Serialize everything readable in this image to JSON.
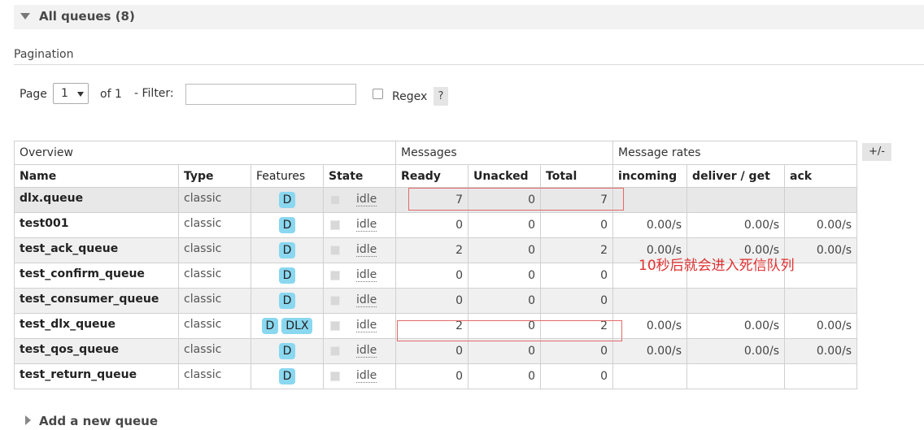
{
  "section": {
    "title": "All queues (8)",
    "add_new": "Add a new queue"
  },
  "pagination": {
    "label": "Pagination",
    "page_label": "Page",
    "page_value": "1",
    "of_label": "of 1",
    "filter_label": "- Filter:",
    "filter_value": "",
    "regex_label": "Regex",
    "help_label": "?"
  },
  "table": {
    "groups": {
      "overview": "Overview",
      "messages": "Messages",
      "rates": "Message rates"
    },
    "toggle_label": "+/-",
    "columns": {
      "name": "Name",
      "type": "Type",
      "features": "Features",
      "state": "State",
      "ready": "Ready",
      "unacked": "Unacked",
      "total": "Total",
      "incoming": "incoming",
      "deliver_get": "deliver / get",
      "ack": "ack"
    },
    "rows": [
      {
        "name": "dlx.queue",
        "type": "classic",
        "f1": "D",
        "f2": "",
        "state": "idle",
        "ready": "7",
        "unacked": "0",
        "total": "7",
        "incoming": "",
        "deliver": "",
        "ack": ""
      },
      {
        "name": "test001",
        "type": "classic",
        "f1": "D",
        "f2": "",
        "state": "idle",
        "ready": "0",
        "unacked": "0",
        "total": "0",
        "incoming": "0.00/s",
        "deliver": "0.00/s",
        "ack": "0.00/s"
      },
      {
        "name": "test_ack_queue",
        "type": "classic",
        "f1": "D",
        "f2": "",
        "state": "idle",
        "ready": "2",
        "unacked": "0",
        "total": "2",
        "incoming": "0.00/s",
        "deliver": "0.00/s",
        "ack": "0.00/s"
      },
      {
        "name": "test_confirm_queue",
        "type": "classic",
        "f1": "D",
        "f2": "",
        "state": "idle",
        "ready": "0",
        "unacked": "0",
        "total": "0",
        "incoming": "",
        "deliver": "",
        "ack": ""
      },
      {
        "name": "test_consumer_queue",
        "type": "classic",
        "f1": "D",
        "f2": "",
        "state": "idle",
        "ready": "0",
        "unacked": "0",
        "total": "0",
        "incoming": "",
        "deliver": "",
        "ack": ""
      },
      {
        "name": "test_dlx_queue",
        "type": "classic",
        "f1": "D",
        "f2": "DLX",
        "state": "idle",
        "ready": "2",
        "unacked": "0",
        "total": "2",
        "incoming": "0.00/s",
        "deliver": "0.00/s",
        "ack": "0.00/s"
      },
      {
        "name": "test_qos_queue",
        "type": "classic",
        "f1": "D",
        "f2": "",
        "state": "idle",
        "ready": "0",
        "unacked": "0",
        "total": "0",
        "incoming": "0.00/s",
        "deliver": "0.00/s",
        "ack": "0.00/s"
      },
      {
        "name": "test_return_queue",
        "type": "classic",
        "f1": "D",
        "f2": "",
        "state": "idle",
        "ready": "0",
        "unacked": "0",
        "total": "0",
        "incoming": "",
        "deliver": "",
        "ack": ""
      }
    ]
  },
  "annotation": "10秒后就会进入死信队列",
  "colors": {
    "feature_badge": "#8ad7f0",
    "annotation_red": "#e03030",
    "highlight_box": "#e26a6a"
  }
}
